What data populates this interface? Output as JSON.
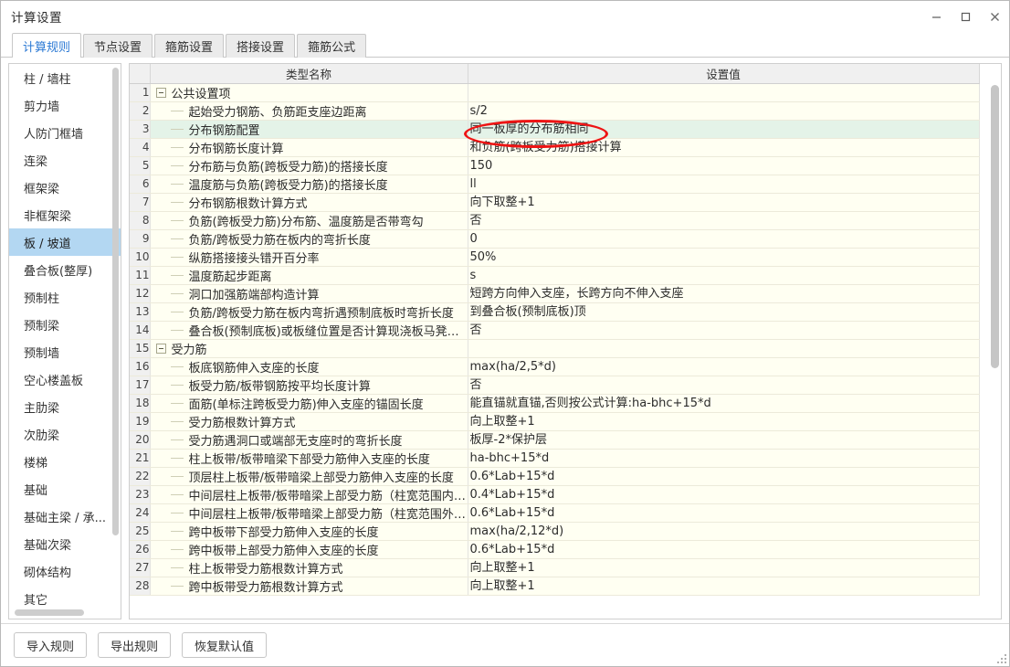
{
  "window": {
    "title": "计算设置",
    "controls": [
      {
        "name": "minimize-button",
        "glyph": "—"
      },
      {
        "name": "maximize-button",
        "glyph": "□"
      },
      {
        "name": "close-button",
        "glyph": "✕"
      }
    ]
  },
  "tabs": [
    {
      "label": "计算规则",
      "active": true
    },
    {
      "label": "节点设置",
      "active": false
    },
    {
      "label": "箍筋设置",
      "active": false
    },
    {
      "label": "搭接设置",
      "active": false
    },
    {
      "label": "箍筋公式",
      "active": false
    }
  ],
  "sidebar": {
    "selected": "板 / 坡道",
    "items": [
      {
        "label": "柱 / 墙柱"
      },
      {
        "label": "剪力墙"
      },
      {
        "label": "人防门框墙"
      },
      {
        "label": "连梁"
      },
      {
        "label": "框架梁"
      },
      {
        "label": "非框架梁"
      },
      {
        "label": "板 / 坡道"
      },
      {
        "label": "叠合板(整厚)"
      },
      {
        "label": "预制柱"
      },
      {
        "label": "预制梁"
      },
      {
        "label": "预制墙"
      },
      {
        "label": "空心楼盖板"
      },
      {
        "label": "主肋梁"
      },
      {
        "label": "次肋梁"
      },
      {
        "label": "楼梯"
      },
      {
        "label": "基础"
      },
      {
        "label": "基础主梁 / 承..."
      },
      {
        "label": "基础次梁"
      },
      {
        "label": "砌体结构"
      },
      {
        "label": "其它"
      }
    ]
  },
  "grid": {
    "headers": {
      "num": "",
      "name": "类型名称",
      "value": "设置值"
    },
    "rows": [
      {
        "num": "1",
        "type": "group",
        "name": "公共设置项",
        "value": ""
      },
      {
        "num": "2",
        "type": "leaf",
        "name": "起始受力钢筋、负筋距支座边距离",
        "value": "s/2"
      },
      {
        "num": "3",
        "type": "leaf",
        "name": "分布钢筋配置",
        "value": "同一板厚的分布筋相同",
        "selected": true,
        "annotated": true
      },
      {
        "num": "4",
        "type": "leaf",
        "name": "分布钢筋长度计算",
        "value": "和负筋(跨板受力筋)搭接计算"
      },
      {
        "num": "5",
        "type": "leaf",
        "name": "分布筋与负筋(跨板受力筋)的搭接长度",
        "value": "150"
      },
      {
        "num": "6",
        "type": "leaf",
        "name": "温度筋与负筋(跨板受力筋)的搭接长度",
        "value": "ll"
      },
      {
        "num": "7",
        "type": "leaf",
        "name": "分布钢筋根数计算方式",
        "value": "向下取整+1"
      },
      {
        "num": "8",
        "type": "leaf",
        "name": "负筋(跨板受力筋)分布筋、温度筋是否带弯勾",
        "value": "否"
      },
      {
        "num": "9",
        "type": "leaf",
        "name": "负筋/跨板受力筋在板内的弯折长度",
        "value": "0"
      },
      {
        "num": "10",
        "type": "leaf",
        "name": "纵筋搭接接头错开百分率",
        "value": "50%"
      },
      {
        "num": "11",
        "type": "leaf",
        "name": "温度筋起步距离",
        "value": "s"
      },
      {
        "num": "12",
        "type": "leaf",
        "name": "洞口加强筋端部构造计算",
        "value": "短跨方向伸入支座，长跨方向不伸入支座"
      },
      {
        "num": "13",
        "type": "leaf",
        "name": "负筋/跨板受力筋在板内弯折遇预制底板时弯折长度",
        "value": "到叠合板(预制底板)顶"
      },
      {
        "num": "14",
        "type": "leaf",
        "name": "叠合板(预制底板)或板缝位置是否计算现浇板马凳筋和拉筋",
        "value": "否"
      },
      {
        "num": "15",
        "type": "group",
        "name": "受力筋",
        "value": ""
      },
      {
        "num": "16",
        "type": "leaf",
        "name": "板底钢筋伸入支座的长度",
        "value": "max(ha/2,5*d)"
      },
      {
        "num": "17",
        "type": "leaf",
        "name": "板受力筋/板带钢筋按平均长度计算",
        "value": "否"
      },
      {
        "num": "18",
        "type": "leaf",
        "name": "面筋(单标注跨板受力筋)伸入支座的锚固长度",
        "value": "能直锚就直锚,否则按公式计算:ha-bhc+15*d"
      },
      {
        "num": "19",
        "type": "leaf",
        "name": "受力筋根数计算方式",
        "value": "向上取整+1"
      },
      {
        "num": "20",
        "type": "leaf",
        "name": "受力筋遇洞口或端部无支座时的弯折长度",
        "value": "板厚-2*保护层"
      },
      {
        "num": "21",
        "type": "leaf",
        "name": "柱上板带/板带暗梁下部受力筋伸入支座的长度",
        "value": "ha-bhc+15*d"
      },
      {
        "num": "22",
        "type": "leaf",
        "name": "顶层柱上板带/板带暗梁上部受力筋伸入支座的长度",
        "value": "0.6*Lab+15*d"
      },
      {
        "num": "23",
        "type": "leaf",
        "name": "中间层柱上板带/板带暗梁上部受力筋（柱宽范围内）伸入...",
        "value": "0.4*Lab+15*d"
      },
      {
        "num": "24",
        "type": "leaf",
        "name": "中间层柱上板带/板带暗梁上部受力筋（柱宽范围外）伸入...",
        "value": "0.6*Lab+15*d"
      },
      {
        "num": "25",
        "type": "leaf",
        "name": "跨中板带下部受力筋伸入支座的长度",
        "value": "max(ha/2,12*d)"
      },
      {
        "num": "26",
        "type": "leaf",
        "name": "跨中板带上部受力筋伸入支座的长度",
        "value": "0.6*Lab+15*d"
      },
      {
        "num": "27",
        "type": "leaf",
        "name": "柱上板带受力筋根数计算方式",
        "value": "向上取整+1"
      },
      {
        "num": "28",
        "type": "leaf",
        "name": "跨中板带受力筋根数计算方式",
        "value": "向上取整+1"
      }
    ]
  },
  "footer": {
    "buttons": [
      {
        "label": "导入规则",
        "name": "import-rules-button"
      },
      {
        "label": "导出规则",
        "name": "export-rules-button"
      },
      {
        "label": "恢复默认值",
        "name": "restore-defaults-button"
      }
    ]
  },
  "colors": {
    "accent": "#2b79d4",
    "selection": "#b3d7f2",
    "row_bg": "#fffff2",
    "row_selected_bg": "#e4f3e8",
    "annotation": "#ee1414"
  }
}
